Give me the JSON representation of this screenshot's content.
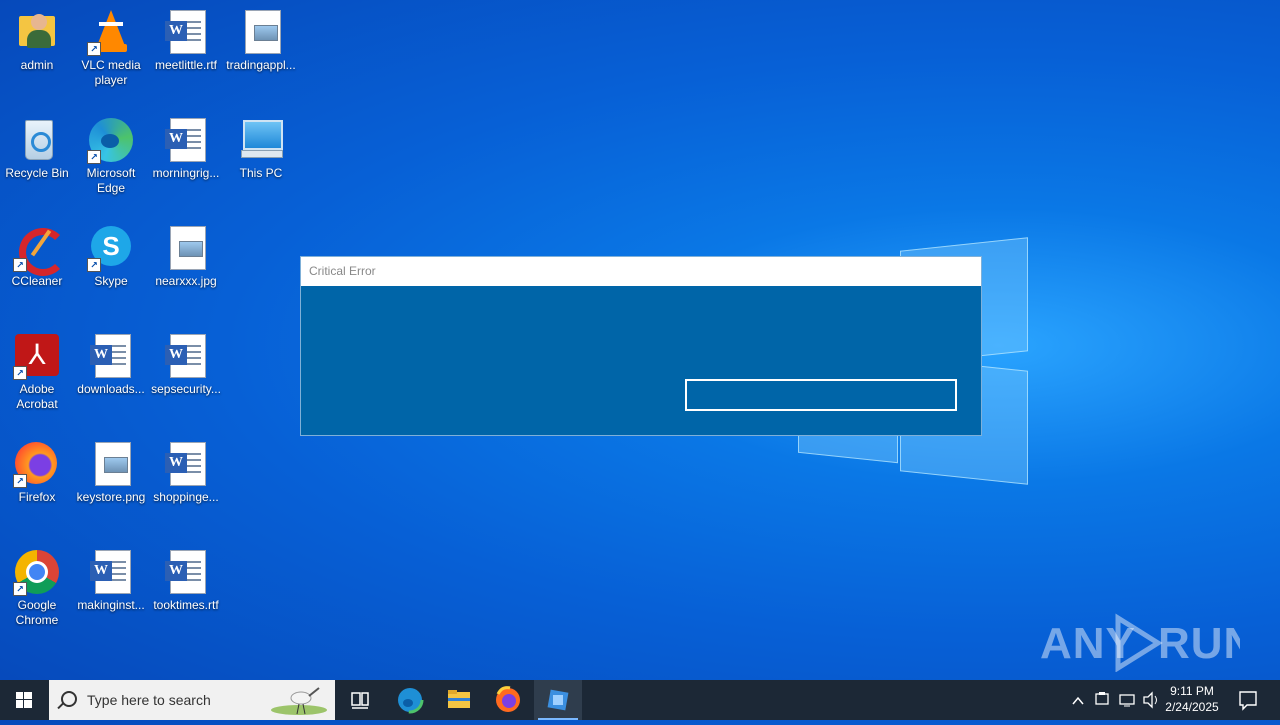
{
  "desktop": {
    "icons": [
      {
        "label": "admin",
        "icon": "user-folder-icon"
      },
      {
        "label": "VLC media player",
        "icon": "vlc-icon"
      },
      {
        "label": "meetlittle.rtf",
        "icon": "word-document-icon"
      },
      {
        "label": "tradingappl...",
        "icon": "image-file-icon"
      },
      {
        "label": "Recycle Bin",
        "icon": "recycle-bin-icon"
      },
      {
        "label": "Microsoft Edge",
        "icon": "edge-icon"
      },
      {
        "label": "morningrig...",
        "icon": "word-document-icon"
      },
      {
        "label": "This PC",
        "icon": "computer-icon"
      },
      {
        "label": "CCleaner",
        "icon": "ccleaner-icon"
      },
      {
        "label": "Skype",
        "icon": "skype-icon"
      },
      {
        "label": "nearxxx.jpg",
        "icon": "image-file-icon"
      },
      {
        "label": "Adobe Acrobat",
        "icon": "acrobat-icon"
      },
      {
        "label": "downloads...",
        "icon": "word-document-icon"
      },
      {
        "label": "sepsecurity...",
        "icon": "word-document-icon"
      },
      {
        "label": "Firefox",
        "icon": "firefox-icon"
      },
      {
        "label": "keystore.png",
        "icon": "image-file-icon"
      },
      {
        "label": "shoppinge...",
        "icon": "word-document-icon"
      },
      {
        "label": "Google Chrome",
        "icon": "chrome-icon"
      },
      {
        "label": "makinginst...",
        "icon": "word-document-icon"
      },
      {
        "label": "tooktimes.rtf",
        "icon": "word-document-icon"
      }
    ]
  },
  "dialog": {
    "title": "Critical Error",
    "button_label": ""
  },
  "watermark": {
    "text": "ANY RUN"
  },
  "taskbar": {
    "search_placeholder": "Type here to search",
    "pinned": [
      "task-view-icon",
      "edge-icon",
      "file-explorer-icon",
      "firefox-icon",
      "app-icon"
    ],
    "clock_time": "9:11 PM",
    "clock_date": "2/24/2025"
  },
  "colors": {
    "dialog_bg": "#0065a8",
    "taskbar_bg": "#1c2836",
    "desktop_accent": "#0a78e6"
  }
}
